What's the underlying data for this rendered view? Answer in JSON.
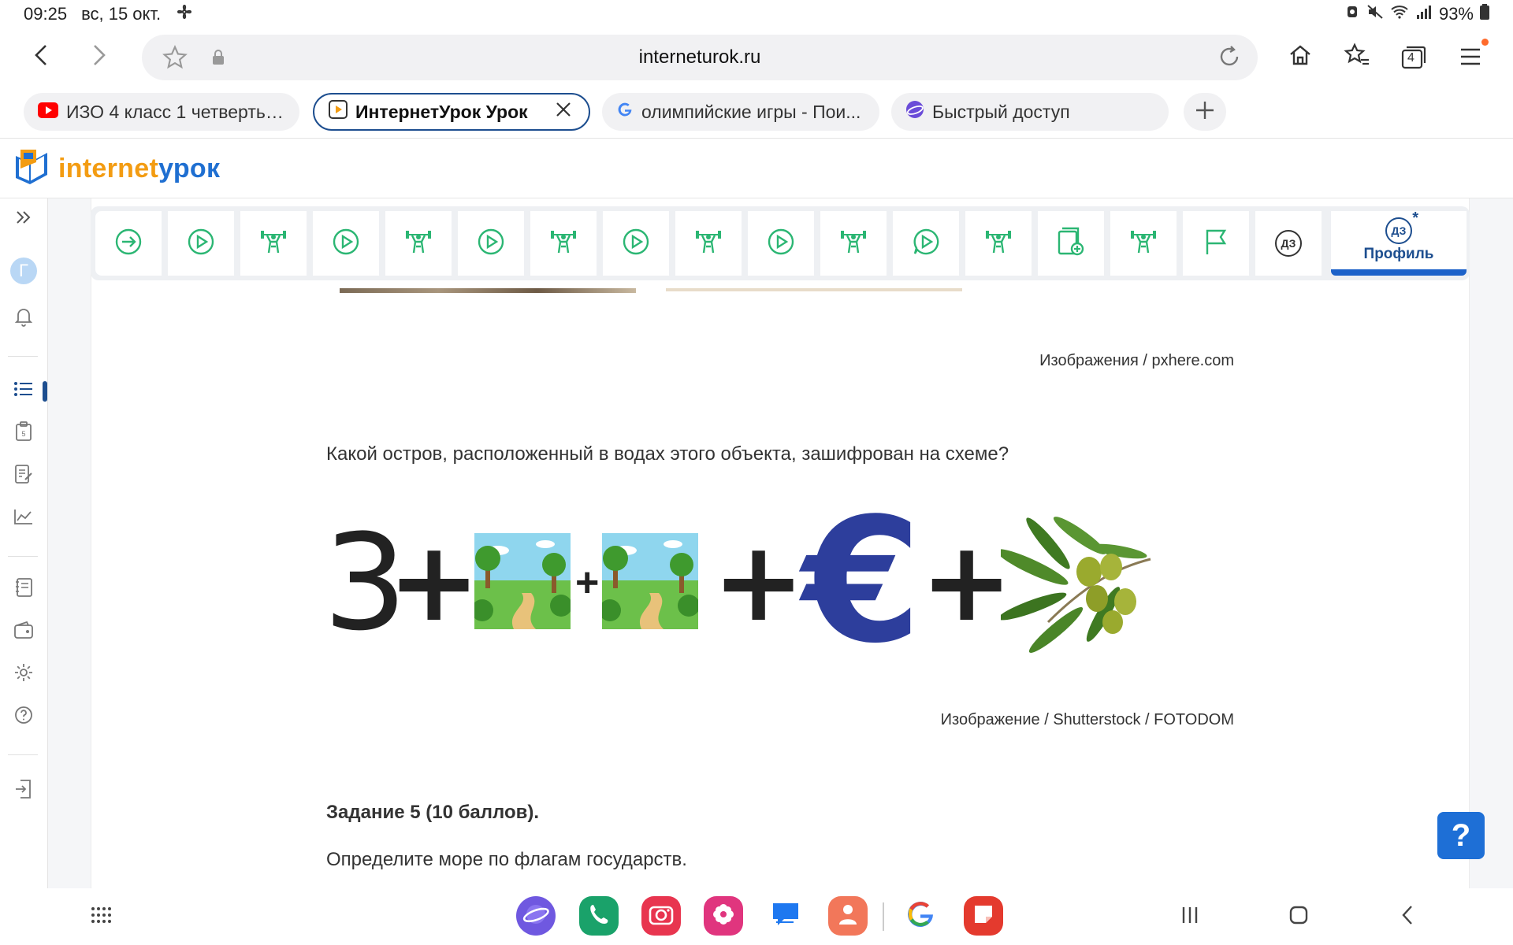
{
  "status_bar": {
    "time": "09:25",
    "date": "вс, 15 окт.",
    "battery": "93%"
  },
  "browser": {
    "url": "interneturok.ru",
    "tabs_count": "4",
    "tabs": [
      {
        "label": "ИЗО 4 класс 1 четверть ...",
        "icon": "youtube-icon"
      },
      {
        "label": "ИнтернетУрок Урок",
        "icon": "play-icon",
        "active": true
      },
      {
        "label": "олимпийские игры - Пои...",
        "icon": "google-icon"
      },
      {
        "label": "Быстрый доступ",
        "icon": "samsung-internet-icon"
      }
    ]
  },
  "site": {
    "logo_part1": "internet",
    "logo_part2": "урок",
    "profile_badge": "ДЗ",
    "profile_label": "Профиль",
    "hw_step_label": "ДЗ",
    "colors": {
      "accent": "#1d62c9",
      "step_green": "#2bb673",
      "logo_orange": "#f39c12",
      "logo_blue": "#1f6fd1"
    }
  },
  "content": {
    "credit_1": "Изображения / pxhere.com",
    "question": "Какой остров, расположенный в водах этого объекта, зашифрован на схеме?",
    "puzzle": {
      "number": "3",
      "plus": "+",
      "euro_symbol": "€"
    },
    "credit_2": "Изображение / Shutterstock / FOTODOM",
    "task_title": "Задание 5 (10 баллов).",
    "task_text": "Определите море по флагам государств."
  },
  "help_button": "?",
  "sidebar": {
    "avatar_letter": "Г"
  }
}
